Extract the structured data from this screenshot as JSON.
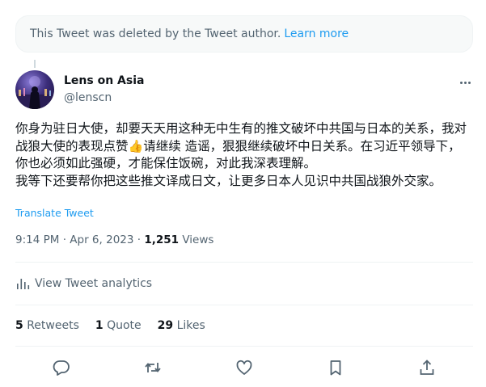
{
  "deleted_notice": {
    "text": "This Tweet was deleted by the Tweet author.",
    "link": "Learn more"
  },
  "author": {
    "name": "Lens on Asia",
    "handle": "@lenscn"
  },
  "tweet": {
    "line1": "你身为驻日大使，却要天天用这种无中生有的推文破坏中共国与日本的关系，我对战狼大使的表现点赞",
    "emoji": "👍",
    "line2": "请继续 造谣，狠狠继续破坏中日关系。在习近平领导下，你也必须如此强硬，才能保住饭碗，对此我深表理解。",
    "line3": "我等下还要帮你把这些推文译成日文，让更多日本人见识中共国战狼外交家。"
  },
  "translate_label": "Translate Tweet",
  "meta": {
    "time": "9:14 PM",
    "separator1": " · ",
    "date": "Apr 6, 2023",
    "separator2": " · ",
    "views_count": "1,251",
    "views_label": " Views"
  },
  "analytics_label": "View Tweet analytics",
  "stats": {
    "retweets_count": "5",
    "retweets_label": "Retweets",
    "quotes_count": "1",
    "quotes_label": "Quote",
    "likes_count": "29",
    "likes_label": "Likes"
  },
  "icons": {
    "more": "more-icon",
    "analytics": "analytics-icon",
    "reply": "reply-icon",
    "retweet": "retweet-icon",
    "like": "like-icon",
    "bookmark": "bookmark-icon",
    "share": "share-icon"
  },
  "colors": {
    "accent": "#1d9bf0",
    "text": "#0f1419",
    "muted": "#536471"
  }
}
